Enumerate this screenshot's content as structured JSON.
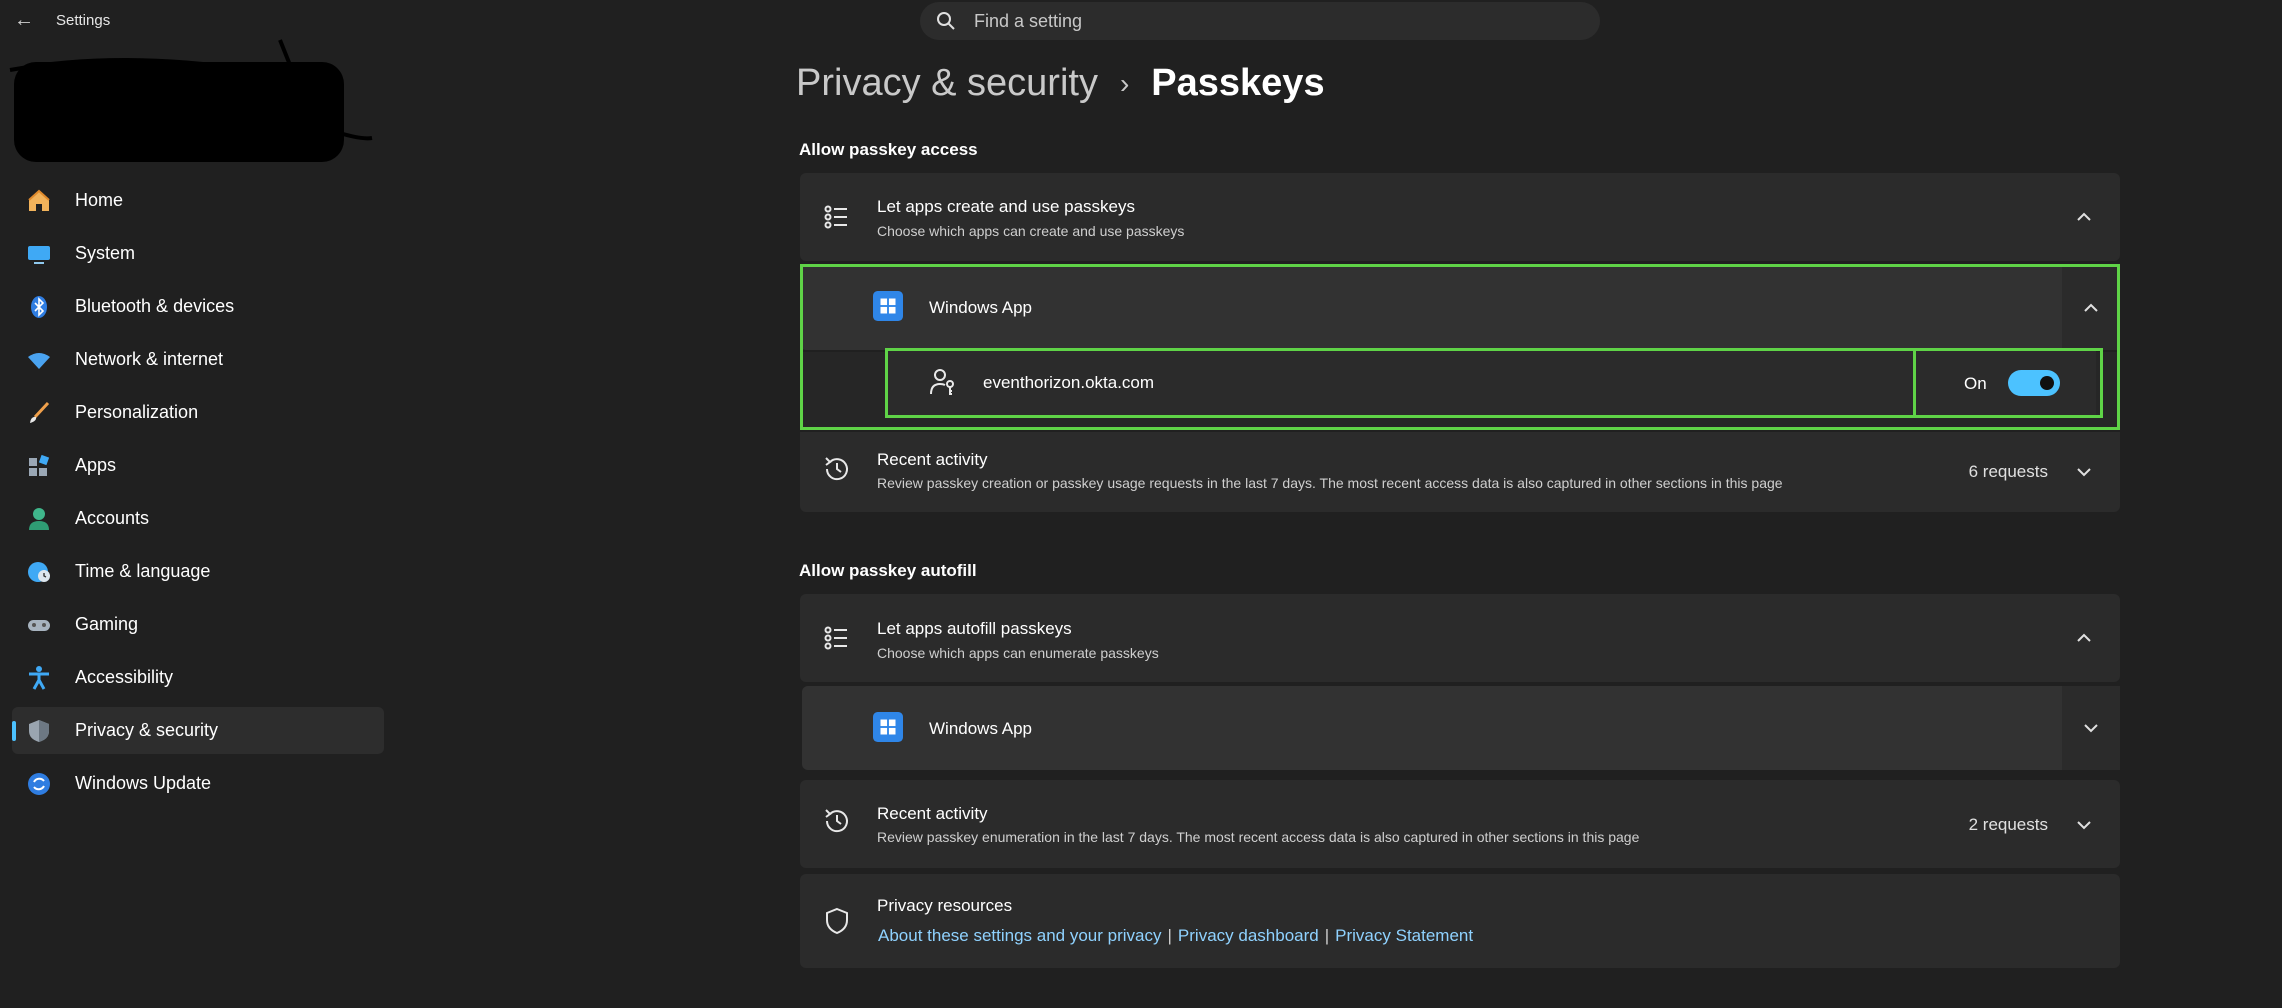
{
  "window": {
    "app_title": "Settings"
  },
  "search": {
    "placeholder": "Find a setting"
  },
  "sidebar": {
    "items": [
      {
        "label": "Home",
        "icon": "home-icon"
      },
      {
        "label": "System",
        "icon": "display-icon"
      },
      {
        "label": "Bluetooth & devices",
        "icon": "bluetooth-icon"
      },
      {
        "label": "Network & internet",
        "icon": "wifi-icon"
      },
      {
        "label": "Personalization",
        "icon": "brush-icon"
      },
      {
        "label": "Apps",
        "icon": "apps-icon"
      },
      {
        "label": "Accounts",
        "icon": "person-icon"
      },
      {
        "label": "Time & language",
        "icon": "globe-clock-icon"
      },
      {
        "label": "Gaming",
        "icon": "gamepad-icon"
      },
      {
        "label": "Accessibility",
        "icon": "accessibility-icon"
      },
      {
        "label": "Privacy & security",
        "icon": "shield-icon",
        "active": true
      },
      {
        "label": "Windows Update",
        "icon": "sync-icon"
      }
    ]
  },
  "breadcrumb": {
    "parent": "Privacy & security",
    "separator": "›",
    "current": "Passkeys"
  },
  "access": {
    "section_title": "Allow passkey access",
    "card": {
      "title": "Let apps create and use passkeys",
      "description": "Choose which apps can create and use passkeys"
    },
    "app": {
      "name": "Windows App"
    },
    "site": {
      "name": "eventhorizon.okta.com",
      "toggle_label": "On",
      "toggle_state": "on"
    },
    "recent": {
      "title": "Recent activity",
      "description": "Review passkey creation or passkey usage requests in the last 7 days. The most recent access data is also captured in other sections in this page",
      "count": "6 requests"
    }
  },
  "autofill": {
    "section_title": "Allow passkey autofill",
    "card": {
      "title": "Let apps autofill passkeys",
      "description": "Choose which apps can enumerate passkeys"
    },
    "app": {
      "name": "Windows App"
    },
    "recent": {
      "title": "Recent activity",
      "description": "Review passkey enumeration in the last 7 days. The most recent access data is also captured in other sections in this page",
      "count": "2 requests"
    }
  },
  "privacy_resources": {
    "title": "Privacy resources",
    "links": [
      "About these settings and your privacy",
      "Privacy dashboard",
      "Privacy Statement"
    ],
    "separator": "|"
  },
  "colors": {
    "accent": "#4cc2ff",
    "highlight": "#5fd347",
    "background": "#202020",
    "card": "#2b2b2b"
  }
}
